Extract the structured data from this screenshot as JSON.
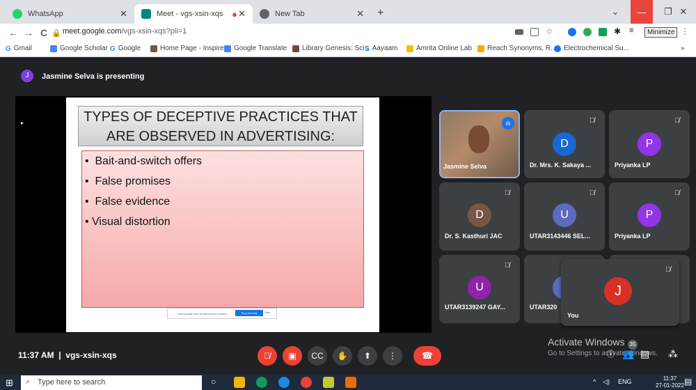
{
  "tabs": [
    {
      "label": "WhatsApp",
      "color": "#25d366"
    },
    {
      "label": "Meet - vgs-xsin-xqs",
      "color": "#00897b"
    },
    {
      "label": "New Tab",
      "color": "#5f6368"
    }
  ],
  "url": {
    "host": "meet.google.com",
    "path": "/vgs-xsin-xqs?pli=1"
  },
  "minimize_label": "Minimize",
  "bookmarks": [
    "Gmail",
    "Google Scholar",
    "Google",
    "Home Page - Inspire",
    "Google Translate",
    "Library Genesis: Sci...",
    "Aayaam",
    "Amrita Online Lab",
    "Reach Synonyms, R...",
    "Electrochemical Su..."
  ],
  "presenter": {
    "initial": "J",
    "text": "Jasmine Selva is presenting"
  },
  "slide": {
    "title_line1": "TYPES OF DECEPTIVE PRACTICES THAT",
    "title_line2": "ARE OBSERVED IN ADVERTISING:",
    "bullets": [
      "Bait-and-switch offers",
      "False promises",
      "False evidence",
      "Visual distortion"
    ],
    "notice": "meet.google.com is sharing your screen.",
    "stop": "Stop sharing",
    "hide": "Hide"
  },
  "participants": [
    {
      "name": "Jasmine Selva",
      "initial": "J",
      "color": "#b5654a"
    },
    {
      "name": "Dr. Mrs. K. Sakaya ...",
      "initial": "D",
      "color": "#1967d2"
    },
    {
      "name": "Priyanka LP",
      "initial": "P",
      "color": "#9334e6"
    },
    {
      "name": "Dr. S. Kasthuri JAC",
      "initial": "D",
      "color": "#795548"
    },
    {
      "name": "UTAR3143446 SEL...",
      "initial": "U",
      "color": "#5c6bc0"
    },
    {
      "name": "Priyanka LP",
      "initial": "P",
      "color": "#9334e6"
    },
    {
      "name": "UTAR3139247 GAY...",
      "initial": "U",
      "color": "#8e24aa"
    },
    {
      "name": "UTAR320",
      "initial": "U",
      "color": "#5c6bc0"
    }
  ],
  "self": {
    "name": "You",
    "initial": "J",
    "color": "#d93025"
  },
  "meeting": {
    "time": "11:37 AM",
    "code": "vgs-xsin-xqs",
    "count": "35"
  },
  "activate": {
    "line1": "Activate Windows",
    "line2": "Go to Settings to activate Windows."
  },
  "taskbar": {
    "search_placeholder": "Type here to search",
    "lang": "ENG",
    "time": "11:37",
    "date": "27-01-2022"
  }
}
